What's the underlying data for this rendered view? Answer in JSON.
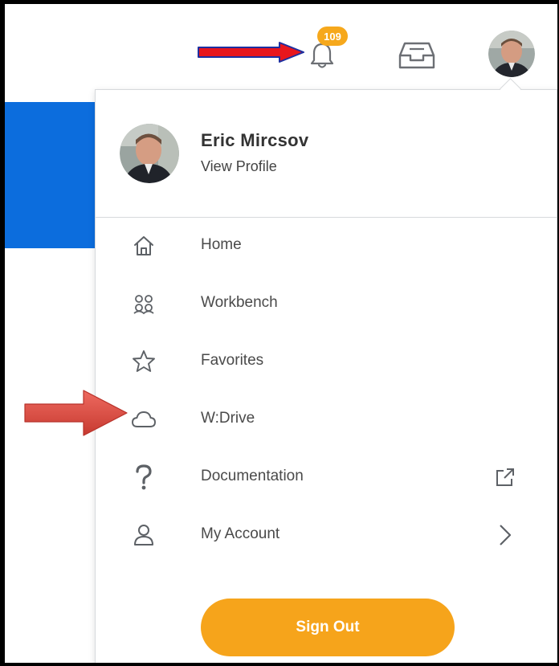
{
  "header": {
    "notifications": {
      "icon": "bell-icon",
      "count": "109"
    },
    "inbox": {
      "icon": "inbox-icon"
    },
    "avatar": {
      "icon": "user-avatar"
    }
  },
  "profile": {
    "name": "Eric Mircsov",
    "link_label": "View Profile"
  },
  "menu": {
    "items": [
      {
        "label": "Home",
        "icon": "home-icon"
      },
      {
        "label": "Workbench",
        "icon": "workbench-icon"
      },
      {
        "label": "Favorites",
        "icon": "star-icon"
      },
      {
        "label": "W:Drive",
        "icon": "cloud-icon"
      },
      {
        "label": "Documentation",
        "icon": "question-icon",
        "trailing": "external-link-icon"
      },
      {
        "label": "My Account",
        "icon": "person-icon",
        "trailing": "chevron-right-icon"
      }
    ],
    "sign_out_label": "Sign Out"
  },
  "annotations": {
    "arrow_top_color": "#e8161d",
    "arrow_top_outline": "#1d2fa0",
    "arrow_side_color": "#e04a3f"
  },
  "colors": {
    "accent_orange": "#f6a41b",
    "brand_blue": "#0c6ddd"
  }
}
